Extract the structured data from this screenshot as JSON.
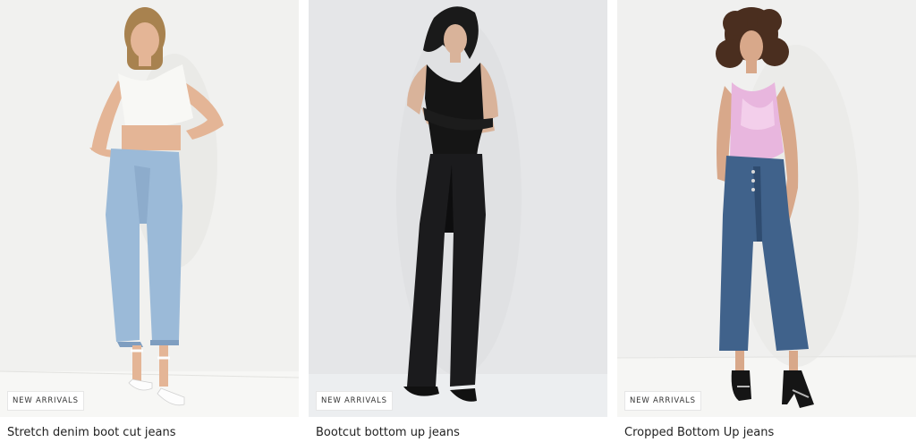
{
  "products": [
    {
      "badge": "NEW ARRIVALS",
      "title": "Stretch denim boot cut jeans",
      "image_alt": "Model wearing light-wash cropped boot cut jeans with white crop top and white strappy heels",
      "colors": {
        "background": "#f1f1ef",
        "floor": "#f7f7f5",
        "top": "#f8f8f5",
        "jeans": "#9bbad8",
        "jeans_shadow": "#7f9ec0",
        "shoes": "#fdfdfd",
        "hair": "#a8824f",
        "skin": "#e4b596"
      }
    },
    {
      "badge": "NEW ARRIVALS",
      "title": "Bootcut bottom up jeans",
      "image_alt": "Model wearing black bootcut jeans with black one-shoulder bodysuit",
      "colors": {
        "background": "#e5e6e8",
        "floor": "#eceef0",
        "top": "#151515",
        "jeans": "#1b1b1d",
        "jeans_shadow": "#0d0d0e",
        "shoes": "#111111",
        "hair": "#1a1a1a",
        "skin": "#d9b39a"
      }
    },
    {
      "badge": "NEW ARRIVALS",
      "title": "Cropped Bottom Up jeans",
      "image_alt": "Model wearing dark-wash cropped flare jeans with pink bodysuit and black heels",
      "colors": {
        "background": "#f0f0ef",
        "floor": "#f6f6f4",
        "top": "#e8b6de",
        "jeans": "#40628b",
        "jeans_shadow": "#2f4c70",
        "shoes": "#151515",
        "hair": "#4a2e1f",
        "skin": "#d8a88a"
      }
    }
  ]
}
